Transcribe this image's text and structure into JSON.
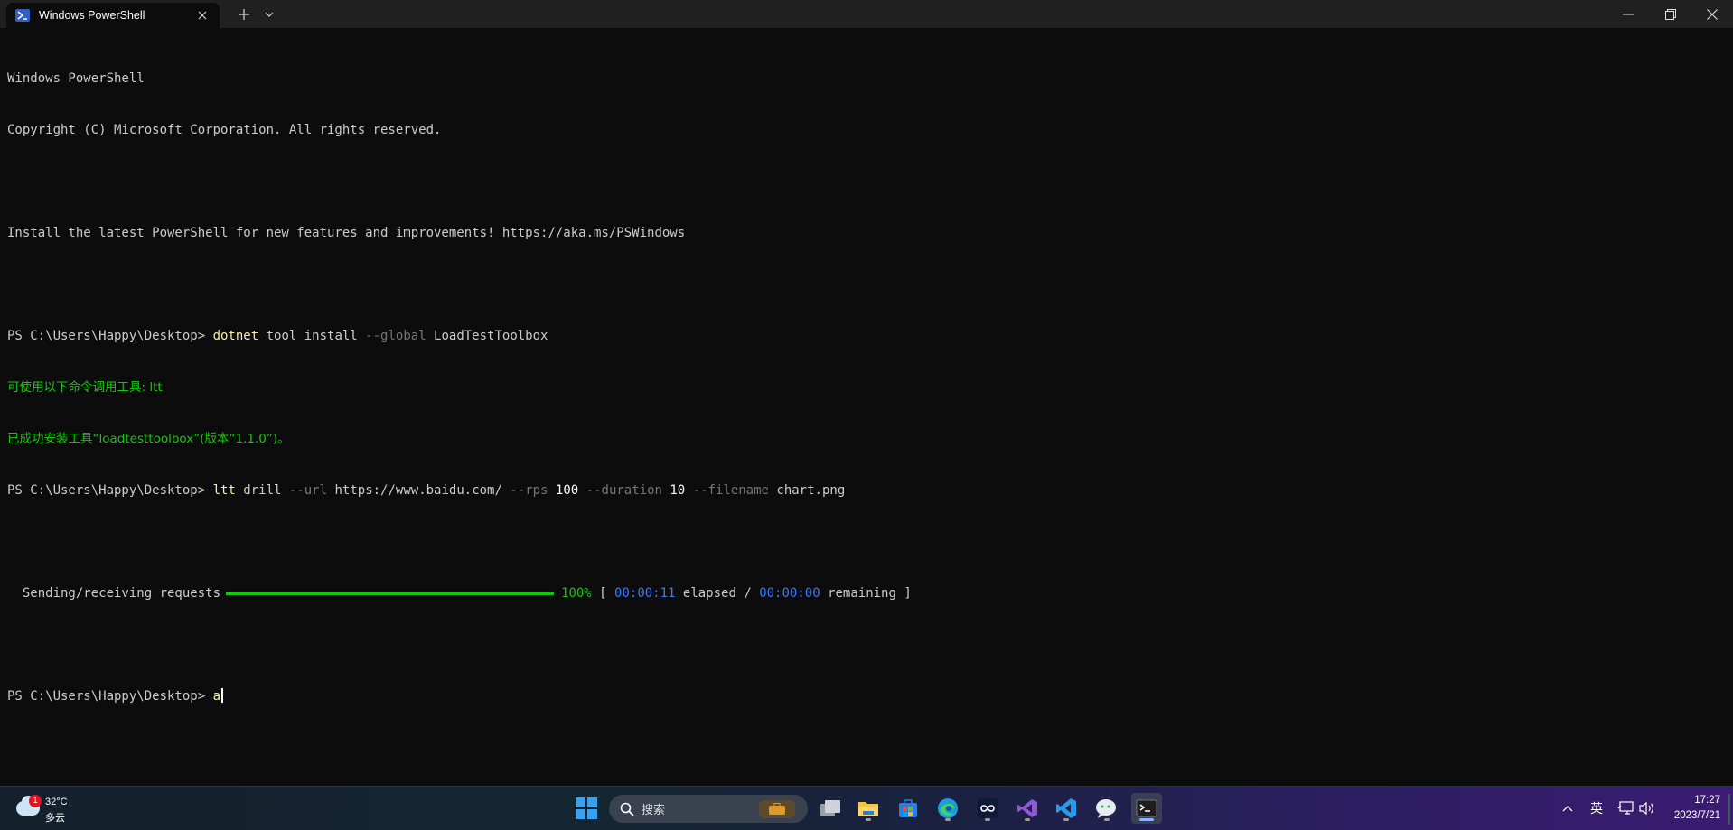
{
  "window": {
    "tab_title": "Windows PowerShell",
    "new_tab_symbol": "+",
    "close_symbol": "✕"
  },
  "terminal": {
    "banner1": "Windows PowerShell",
    "banner2": "Copyright (C) Microsoft Corporation. All rights reserved.",
    "banner3": "Install the latest PowerShell for new features and improvements! https://aka.ms/PSWindows",
    "prompt": "PS C:\\Users\\Happy\\Desktop> ",
    "cmd1": {
      "program": "dotnet",
      "args": " tool install ",
      "flag": "--global",
      "value": " LoadTestToolbox"
    },
    "out1": "可使用以下命令调用工具: ltt",
    "out2": "已成功安装工具“loadtesttoolbox”(版本“1.1.0”)。",
    "cmd2": {
      "program": "ltt",
      "a1": " drill ",
      "f1": "--url",
      "v1": " https://www.baidu.com/ ",
      "f2": "--rps",
      "v2": " 100 ",
      "f3": "--duration",
      "v3": " 10 ",
      "f4": "--filename",
      "v4": " chart.png"
    },
    "progress": {
      "label": "  Sending/receiving requests",
      "percent_text": "100%",
      "percent_value": 1.0,
      "bracket_open": " [ ",
      "elapsed_time": "00:00:11",
      "elapsed_label": " elapsed / ",
      "remaining_time": "00:00:00",
      "remaining_label": " remaining ]"
    },
    "current_input": "a"
  },
  "taskbar": {
    "weather_badge": "1",
    "weather_temp": "32°C",
    "weather_condition": "多云",
    "search_placeholder": "搜索",
    "tray_up_arrow": "^",
    "ime_label": "英",
    "clock_time": "17:27",
    "clock_date": "2023/7/21"
  },
  "colors": {
    "terminal_bg": "#0c0c0c",
    "command_yellow": "#f9f1a5",
    "flag_gray": "#767676",
    "success_green": "#16c60c",
    "time_blue": "#3b78ff"
  }
}
